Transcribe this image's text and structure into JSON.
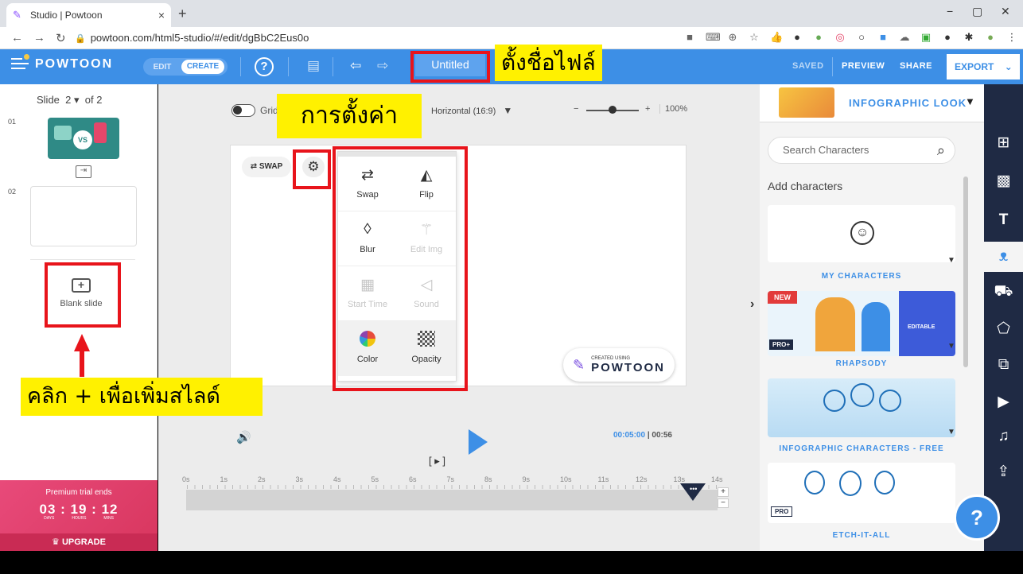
{
  "browser": {
    "tab_title": "Studio | Powtoon",
    "tab_close": "×",
    "new_tab": "+",
    "url": "powtoon.com/html5-studio/#/edit/dgBbC2Eus0o",
    "win_min": "−",
    "win_max": "▢",
    "win_close": "✕"
  },
  "topbar": {
    "brand": "POWTOON",
    "mode_edit": "EDIT",
    "mode_create": "CREATE",
    "help": "?",
    "title": "Untitled",
    "saved": "SAVED",
    "preview": "PREVIEW",
    "share": "SHARE",
    "export": "EXPORT",
    "export_caret": "⌄"
  },
  "slides": {
    "label": "Slide",
    "current": "2",
    "total": "of 2",
    "items": [
      {
        "num": "01",
        "thumb_text": "VS"
      },
      {
        "num": "02"
      }
    ],
    "blank_slide": "Blank slide"
  },
  "canvas_toolbar": {
    "grid": "Grid",
    "aspect": "Horizontal (16:9)",
    "zoom_minus": "−",
    "zoom_plus": "+",
    "zoom": "100%",
    "zoom_level": 0.5
  },
  "canvas": {
    "swap": "SWAP",
    "created_small": "CREATED USING",
    "created_brand": "POWTOON"
  },
  "settings_menu": {
    "items": [
      {
        "label": "Swap",
        "enabled": true
      },
      {
        "label": "Flip",
        "enabled": true
      },
      {
        "label": "Blur",
        "enabled": true
      },
      {
        "label": "Edit Img",
        "enabled": false
      },
      {
        "label": "Start Time",
        "enabled": false
      },
      {
        "label": "Sound",
        "enabled": false
      },
      {
        "label": "Color",
        "enabled": true
      },
      {
        "label": "Opacity",
        "enabled": true
      }
    ]
  },
  "playback": {
    "current_time": "00:05:00",
    "total_time": "00:56",
    "ruler": [
      "0s",
      "1s",
      "2s",
      "3s",
      "4s",
      "5s",
      "6s",
      "7s",
      "8s",
      "9s",
      "10s",
      "11s",
      "12s",
      "13s",
      "14s"
    ]
  },
  "premium": {
    "title": "Premium trial ends",
    "days": "03",
    "hours": "19",
    "mins": "12",
    "days_lbl": "DAYS",
    "hours_lbl": "HOURS",
    "mins_lbl": "MINS",
    "upgrade": "UPGRADE"
  },
  "right_panel": {
    "style": "INFOGRAPHIC LOOK",
    "search_placeholder": "Search Characters",
    "add_characters": "Add characters",
    "cards": [
      {
        "label": "MY CHARACTERS"
      },
      {
        "label": "RHAPSODY",
        "badge_new": "NEW",
        "badge_pro": "PRO+",
        "badge_editable": "EDITABLE"
      },
      {
        "label": "INFOGRAPHIC CHARACTERS - FREE"
      },
      {
        "label": "ETCH-IT-ALL",
        "badge_pro": "PRO"
      }
    ]
  },
  "help_fab": "?",
  "annotations": {
    "rename_file": "ตั้งชื่อไฟล์",
    "settings": "การตั้งค่า",
    "add_slide": "คลิก + เพื่อเพิ่มสไลด์"
  },
  "colors": {
    "brand_blue": "#3d8fe6",
    "rail_navy": "#1f2a44",
    "annotation_red": "#e8141b",
    "annotation_yellow": "#fff100",
    "premium_pink": "#e84a7a"
  }
}
